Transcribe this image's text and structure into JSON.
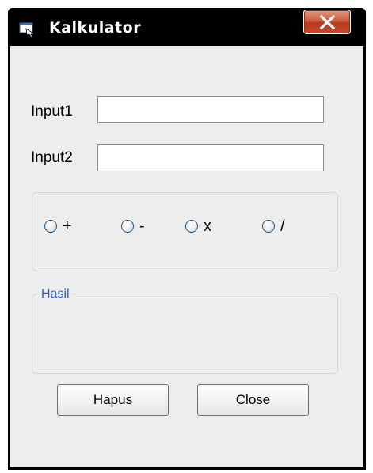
{
  "window": {
    "title": "Kalkulator",
    "icon": "app-window-icon",
    "close_icon": "close-x-icon"
  },
  "form": {
    "input1": {
      "label": "Input1",
      "value": "",
      "placeholder": ""
    },
    "input2": {
      "label": "Input2",
      "value": "",
      "placeholder": ""
    },
    "operators": [
      {
        "label": "+",
        "selected": false
      },
      {
        "label": "-",
        "selected": false
      },
      {
        "label": "x",
        "selected": false
      },
      {
        "label": "/",
        "selected": false
      }
    ],
    "result": {
      "caption": "Hasil",
      "value": ""
    },
    "buttons": {
      "clear_label": "Hapus",
      "close_label": "Close"
    }
  },
  "colors": {
    "title_bar": "#000000",
    "client_background": "#ededed",
    "group_caption": "#2f5fcf",
    "close_button": "#c54b2d"
  }
}
